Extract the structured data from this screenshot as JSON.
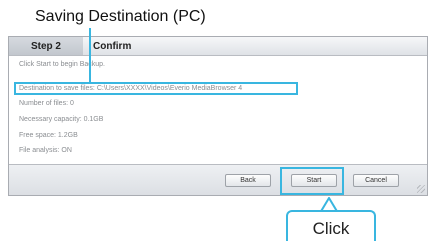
{
  "callout": {
    "title": "Saving Destination (PC)",
    "click_label": "Click"
  },
  "wizard": {
    "step_tab": "Step 2",
    "confirm_tab": "Confirm",
    "lines": [
      "Click Start to begin Backup.",
      "Destination to save files: C:\\Users\\XXXX\\Videos\\Everio MediaBrowser 4",
      "Number of files: 0",
      "Necessary capacity: 0.1GB",
      "Free space: 1.2GB",
      "File analysis: ON"
    ]
  },
  "buttons": {
    "back": "Back",
    "start": "Start",
    "cancel": "Cancel"
  },
  "colors": {
    "highlight": "#39b6e0"
  }
}
